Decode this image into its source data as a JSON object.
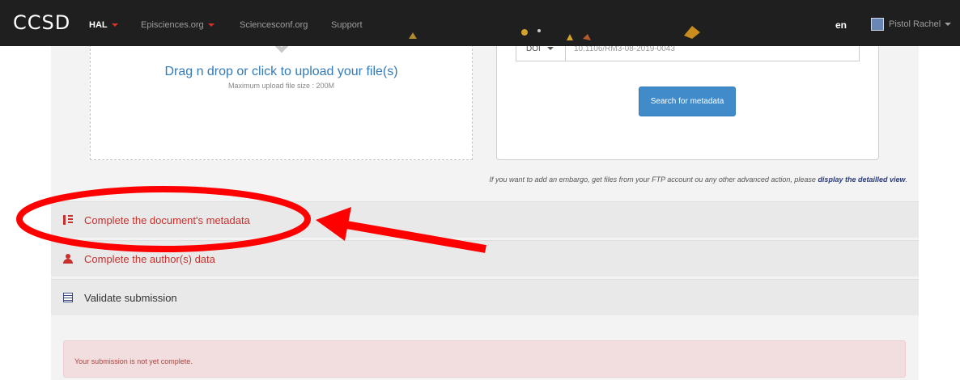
{
  "navbar": {
    "brand": "CCSD",
    "items": [
      {
        "label": "HAL",
        "active": true,
        "has_caret": true
      },
      {
        "label": "Episciences.org",
        "active": false,
        "has_caret": true
      },
      {
        "label": "Sciencesconf.org",
        "active": false,
        "has_caret": false
      },
      {
        "label": "Support",
        "active": false,
        "has_caret": false
      }
    ],
    "language": "en",
    "user": "Pistol Rachel"
  },
  "upload": {
    "title": "Drag n drop or click to upload your file(s)",
    "max_size": "Maximum upload file size : 200M"
  },
  "metadata_search": {
    "id_type": "DOI",
    "id_value": "10.1106/RM3-08-2019-0043",
    "button_label": "Search for metadata"
  },
  "embargo_note": {
    "text": "If you want to add an embargo, get files from your FTP account ou any other advanced action, please ",
    "link": "display the detailled view",
    "suffix": "."
  },
  "sections": [
    {
      "label": "Complete the document's metadata",
      "icon": "list-icon",
      "status": "incomplete"
    },
    {
      "label": "Complete the author(s) data",
      "icon": "user-icon",
      "status": "incomplete"
    },
    {
      "label": "Validate submission",
      "icon": "document-icon",
      "status": "pending"
    }
  ],
  "alert": {
    "message": "Your submission is not yet complete."
  },
  "colors": {
    "navbar_bg": "#1f1f1f",
    "link_blue": "#337ab7",
    "button_blue": "#428bca",
    "error_red": "#c9302c",
    "annotation_red": "#ff0000",
    "alert_bg": "#f2dede"
  }
}
